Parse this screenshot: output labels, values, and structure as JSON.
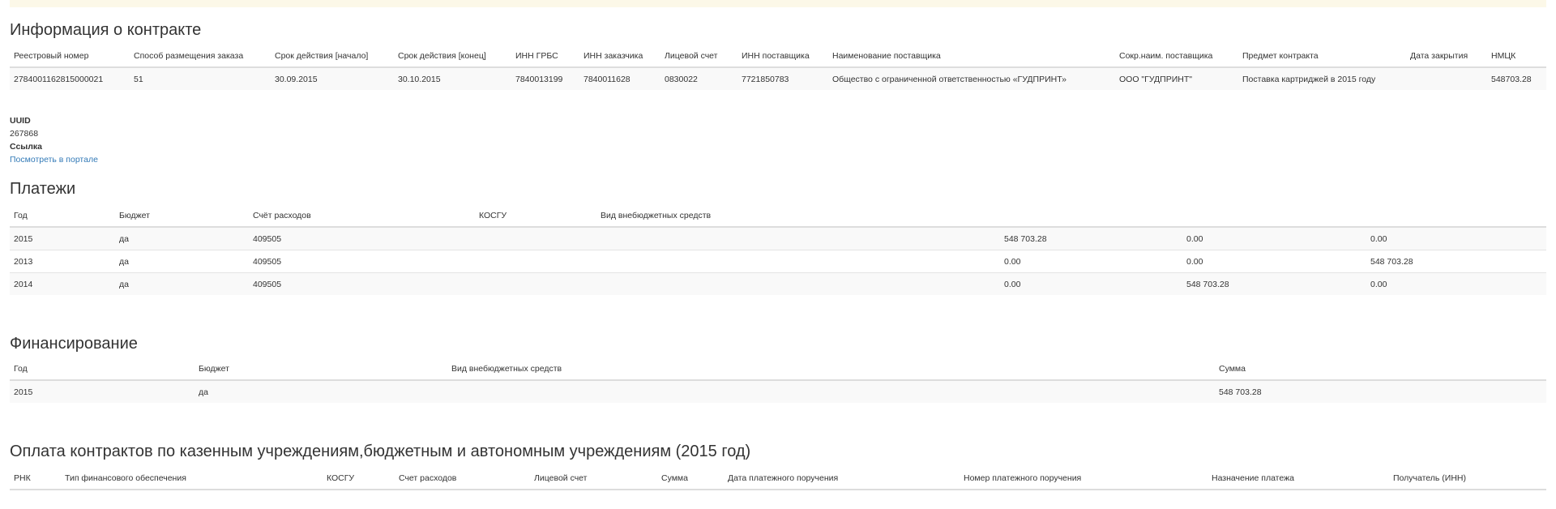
{
  "contract": {
    "title": "Информация о контракте",
    "headers": [
      "Реестровый номер",
      "Способ размещения заказа",
      "Срок действия [начало]",
      "Срок действия [конец]",
      "ИНН ГРБС",
      "ИНН заказчика",
      "Лицевой счет",
      "ИНН поставщика",
      "Наименование поставщика",
      "Сокр.наим. поставщика",
      "Предмет контракта",
      "Дата закрытия",
      "НМЦК"
    ],
    "row": [
      "2784001162815000021",
      "51",
      "30.09.2015",
      "30.10.2015",
      "7840013199",
      "7840011628",
      "0830022",
      "7721850783",
      "Общество с ограниченной ответственностью «ГУДПРИНТ»",
      "ООО \"ГУДПРИНТ\"",
      "Поставка картриджей в 2015 году",
      "",
      "548703.28"
    ]
  },
  "meta": {
    "uuid_label": "UUID",
    "uuid_value": "267868",
    "link_label": "Ссылка",
    "link_text": "Посмотреть в портале"
  },
  "payments": {
    "title": "Платежи",
    "headers": [
      "Год",
      "Бюджет",
      "Счёт расходов",
      "КОСГУ",
      "Вид внебюджетных средств",
      "",
      "",
      ""
    ],
    "rows": [
      [
        "2015",
        "да",
        "409505",
        "",
        "",
        "548 703.28",
        "0.00",
        "0.00"
      ],
      [
        "2013",
        "да",
        "409505",
        "",
        "",
        "0.00",
        "0.00",
        "548 703.28"
      ],
      [
        "2014",
        "да",
        "409505",
        "",
        "",
        "0.00",
        "548 703.28",
        "0.00"
      ]
    ]
  },
  "financing": {
    "title": "Финансирование",
    "headers": [
      "Год",
      "Бюджет",
      "Вид внебюджетных средств",
      "Сумма"
    ],
    "rows": [
      [
        "2015",
        "да",
        "",
        "548 703.28"
      ]
    ]
  },
  "contract_payments": {
    "title": "Оплата контрактов по казенным учреждениям,бюджетным и автономным учреждениям (2015 год)",
    "headers": [
      "РНК",
      "Тип финансового обеспечения",
      "КОСГУ",
      "Счет расходов",
      "Лицевой счет",
      "Сумма",
      "Дата платежного поручения",
      "Номер платежного поручения",
      "Назначение платежа",
      "Получатель (ИНН)"
    ]
  }
}
